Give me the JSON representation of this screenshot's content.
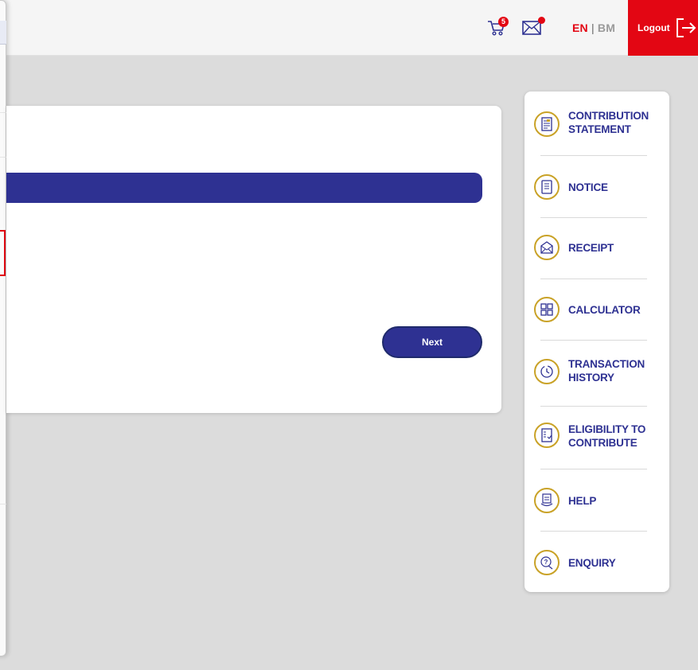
{
  "header": {
    "cart_count": "5",
    "lang_en": "EN",
    "lang_separator": "|",
    "lang_bm": "BM",
    "logout_label": "Logout"
  },
  "main": {
    "next_label": "Next"
  },
  "quick_menu": {
    "items": [
      {
        "label_1": "CONTRIBUTION",
        "label_2": "STATEMENT",
        "icon": "statement-icon"
      },
      {
        "label_1": "NOTICE",
        "label_2": "",
        "icon": "notice-icon"
      },
      {
        "label_1": "RECEIPT",
        "label_2": "",
        "icon": "receipt-icon"
      },
      {
        "label_1": "CALCULATOR",
        "label_2": "",
        "icon": "calculator-icon"
      },
      {
        "label_1": "TRANSACTION",
        "label_2": "HISTORY",
        "icon": "history-icon"
      },
      {
        "label_1": "ELIGIBILITY TO",
        "label_2": "CONTRIBUTE",
        "icon": "eligibility-icon"
      },
      {
        "label_1": "HELP",
        "label_2": "",
        "icon": "help-icon"
      },
      {
        "label_1": "ENQUIRY",
        "label_2": "",
        "icon": "enquiry-icon"
      }
    ]
  },
  "colors": {
    "brand_blue": "#2e3192",
    "brand_red": "#e30613",
    "icon_gold": "#c9a227"
  }
}
